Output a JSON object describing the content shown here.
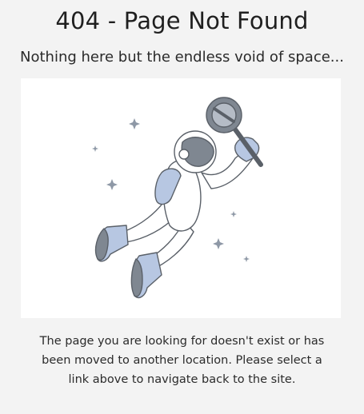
{
  "page": {
    "title": "404 - Page Not Found",
    "subtitle": "Nothing here but the endless void of space...",
    "message": "The page you are looking for doesn't exist or has been moved to another location. Please select a link above to navigate back to the site."
  },
  "illustration": {
    "icon": "astronaut-floating-with-magnifying-glass",
    "colors": {
      "outline": "#5a6068",
      "visor": "#7f8791",
      "boots": "#b7c7e2",
      "stars": "#8e98a6",
      "background": "#ffffff"
    }
  }
}
